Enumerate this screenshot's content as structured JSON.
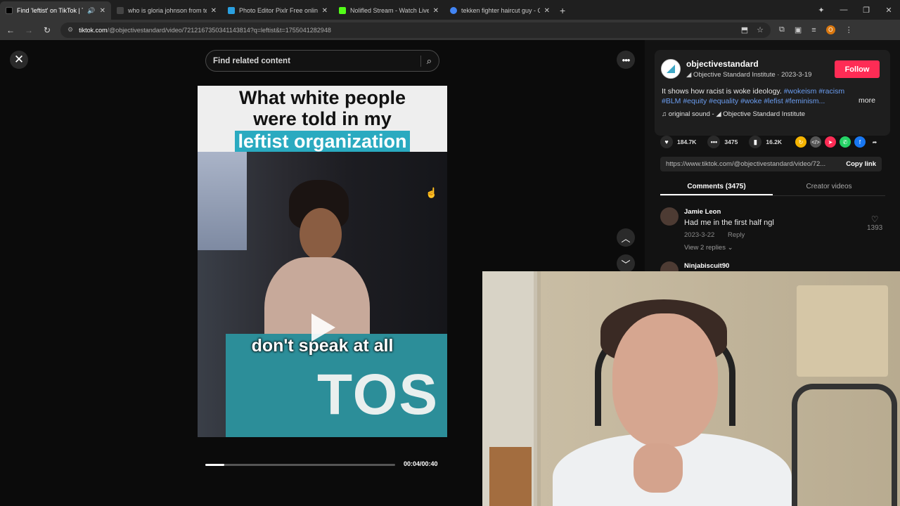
{
  "browser": {
    "tabs": [
      {
        "title": "Find 'leftist' on TikTok | TikTok",
        "active": true,
        "color": "#000000"
      },
      {
        "title": "who is gloria johnson from tennessee",
        "active": false,
        "color": "#444444"
      },
      {
        "title": "Photo Editor Pixlr Free online Image",
        "active": false,
        "color": "#2aa0e0"
      },
      {
        "title": "Nolifled Stream - Watch Live on",
        "active": false,
        "color": "#53fc18"
      },
      {
        "title": "tekken fighter haircut guy - Google",
        "active": false,
        "color": "#4285f4"
      }
    ],
    "url_host": "tiktok.com",
    "url_path": "/@objectivestandard/video/7212167350341143814?q=leftist&t=1755041282948"
  },
  "search": {
    "placeholder": "Find related content"
  },
  "video": {
    "top_text_line1": "What white people",
    "top_text_line2": "were told in my",
    "top_text_highlight": "leftist organization",
    "caption": "don't speak at all",
    "podium_logo": "TOS",
    "time": "00:04/00:40",
    "progress": 0.1
  },
  "panel": {
    "author": "objectivestandard",
    "author_sub": "◢ Objective Standard Institute · 2023-3-19",
    "follow_label": "Follow",
    "desc_text": "It shows how racist is woke ideology.",
    "tags_line1": "#wokeism #racism",
    "tags_line2": "#BLM #equity #equality #woke #lefist #feminism...",
    "more_label": "more",
    "sound": "original sound - ◢ Objective Standard Institute",
    "likes": "184.7K",
    "comments": "3475",
    "saves": "16.2K",
    "link": "https://www.tiktok.com/@objectivestandard/video/72...",
    "copy_label": "Copy link",
    "tab_comments": "Comments (3475)",
    "tab_creator": "Creator videos",
    "comment1": {
      "name": "Jamie Leon",
      "text": "Had me in the first half ngl",
      "date": "2023-3-22",
      "reply": "Reply",
      "likes": "1393",
      "replies": "View 2 replies ⌄"
    },
    "comment2": {
      "name": "Ninjabiscuit90"
    }
  },
  "colors": {
    "follow": "#fe2c55",
    "hashtag": "#6b9df0",
    "caption_highlight": "#2aaac0"
  }
}
